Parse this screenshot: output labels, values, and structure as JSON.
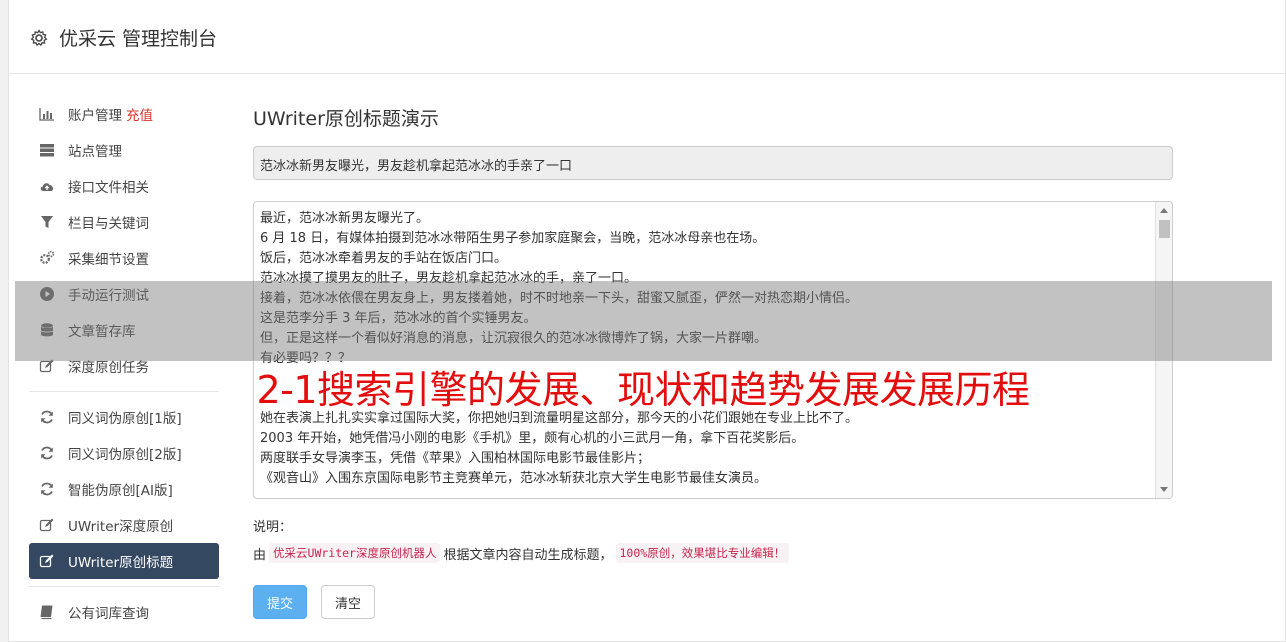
{
  "header": {
    "title": "优采云 管理控制台"
  },
  "sidebar": {
    "group1": [
      {
        "label": "账户管理",
        "extra": "充值",
        "icon": "bar-chart-icon"
      },
      {
        "label": "站点管理",
        "icon": "server-icon"
      },
      {
        "label": "接口文件相关",
        "icon": "cloud-upload-icon"
      },
      {
        "label": "栏目与关键词",
        "icon": "filter-icon"
      },
      {
        "label": "采集细节设置",
        "icon": "gears-icon"
      },
      {
        "label": "手动运行测试",
        "icon": "play-icon"
      },
      {
        "label": "文章暂存库",
        "icon": "database-icon"
      },
      {
        "label": "深度原创任务",
        "icon": "edit-icon"
      }
    ],
    "group2": [
      {
        "label": "同义词伪原创[1版]",
        "icon": "refresh-icon"
      },
      {
        "label": "同义词伪原创[2版]",
        "icon": "refresh-icon"
      },
      {
        "label": "智能伪原创[AI版]",
        "icon": "refresh-icon"
      },
      {
        "label": "UWriter深度原创",
        "icon": "edit-icon"
      },
      {
        "label": "UWriter原创标题",
        "icon": "edit-icon",
        "active": true
      }
    ],
    "group3": [
      {
        "label": "公有词库查询",
        "icon": "book-icon"
      }
    ]
  },
  "main": {
    "title": "UWriter原创标题演示",
    "generated_title": "范冰冰新男友曝光，男友趁机拿起范冰冰的手亲了一口",
    "article_lines": [
      "最近，范冰冰新男友曝光了。",
      "6 月 18 日，有媒体拍摄到范冰冰带陌生男子参加家庭聚会，当晚，范冰冰母亲也在场。",
      "饭后，范冰冰牵着男友的手站在饭店门口。",
      "范冰冰摸了摸男友的肚子，男友趁机拿起范冰冰的手，亲了一口。",
      "接着，范冰冰依偎在男友身上，男友搂着她，时不时地亲一下头，甜蜜又腻歪，俨然一对热恋期小情侣。",
      "这是范李分手 3 年后，范冰冰的首个实锤男友。",
      "但，正是这样一个看似好消息的消息，让沉寂很久的范冰冰微博炸了锅，大家一片群嘲。",
      "有必要吗？？？",
      "",
      "",
      "她在表演上扎扎实实拿过国际大奖，你把她归到流量明星这部分，那今天的小花们跟她在专业上比不了。",
      "2003 年开始，她凭借冯小刚的电影《手机》里，颇有心机的小三武月一角，拿下百花奖影后。",
      "两度联手女导演李玉，凭借《苹果》入围柏林国际电影节最佳影片；",
      "《观音山》入围东京国际电影节主竞赛单元，范冰冰斩获北京大学生电影节最佳女演员。"
    ],
    "note_label": "说明：",
    "note_prefix": "由",
    "note_code1": "优采云UWriter深度原创机器人",
    "note_middle": "根据文章内容自动生成标题，",
    "note_code2": "100%原创，效果堪比专业编辑！",
    "submit_label": "提交",
    "clear_label": "清空"
  },
  "overlay": {
    "text": "2-1搜索引擎的发展、现状和趋势发展发展历程"
  }
}
